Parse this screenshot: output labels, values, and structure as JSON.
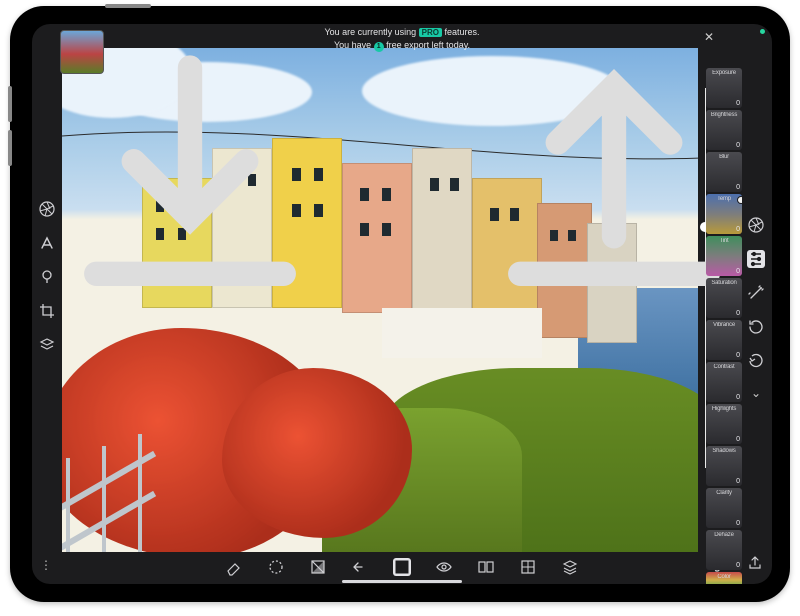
{
  "banner": {
    "line1_pre": "You are currently using ",
    "pro_tag": "PRO",
    "line1_post": " features.",
    "line2_pre": "You have ",
    "count": "1",
    "line2_post": " free export left today."
  },
  "adjustments": [
    {
      "label": "Exposure",
      "value": "0",
      "style": "plain"
    },
    {
      "label": "Brightness",
      "value": "0",
      "style": "plain"
    },
    {
      "label": "Blur",
      "value": "0",
      "style": "plain"
    },
    {
      "label": "Temp",
      "value": "0",
      "style": "grad-bgy",
      "knob": true
    },
    {
      "label": "Tint",
      "value": "0",
      "style": "grad-gm"
    },
    {
      "label": "Saturation",
      "value": "0",
      "style": "plain"
    },
    {
      "label": "Vibrance",
      "value": "0",
      "style": "plain"
    },
    {
      "label": "Contrast",
      "value": "0",
      "style": "plain"
    },
    {
      "label": "Highlights",
      "value": "0",
      "style": "plain"
    },
    {
      "label": "Shadows",
      "value": "0",
      "style": "plain"
    },
    {
      "label": "Clarity",
      "value": "0",
      "style": "plain"
    },
    {
      "label": "Dehaze",
      "value": "0",
      "style": "plain"
    },
    {
      "label": "Color",
      "value": "",
      "style": "grad-rainbow"
    }
  ],
  "left_tools": [
    "aperture",
    "text",
    "brush-dot",
    "crop",
    "layers"
  ],
  "right_tools": [
    "aperture",
    "sliders",
    "magic-wand",
    "history",
    "reset"
  ],
  "right_active_index": 1,
  "bottom_tools": [
    "eraser",
    "selection",
    "mask",
    "undo",
    "auto-enhance",
    "eye",
    "compare",
    "grid",
    "stack"
  ],
  "bottom_active_index": 4
}
